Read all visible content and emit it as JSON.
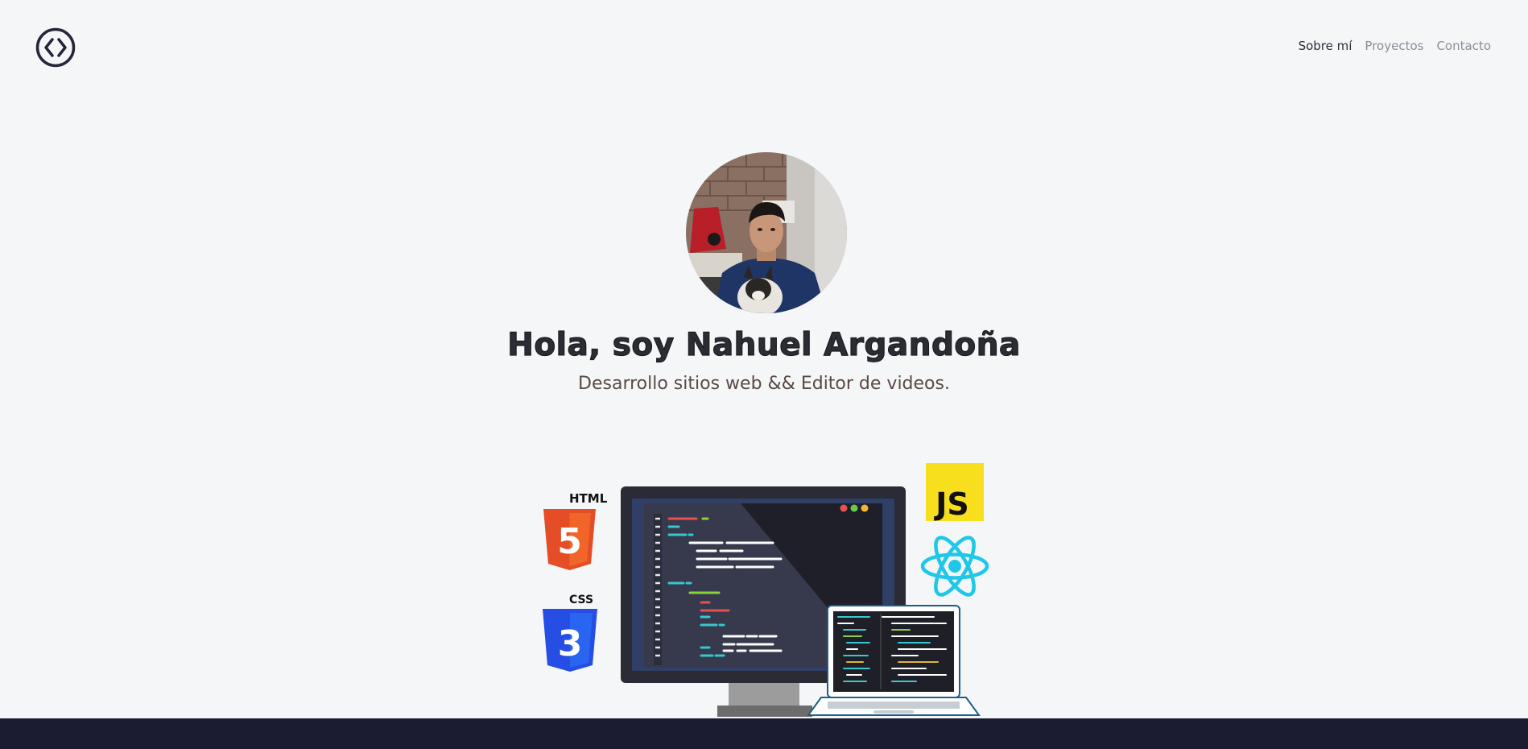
{
  "header": {
    "logo_icon": "code-brackets-icon",
    "nav": [
      {
        "label": "Sobre mí",
        "active": true
      },
      {
        "label": "Proyectos",
        "active": false
      },
      {
        "label": "Contacto",
        "active": false
      }
    ]
  },
  "hero": {
    "title": "Hola, soy Nahuel Argandoña",
    "subtitle": "Desarrollo sitios web && Editor de videos."
  },
  "tech_logos": {
    "html": "HTML",
    "html_number": "5",
    "css": "CSS",
    "css_number": "3",
    "js": "JS",
    "react_icon": "react-atom-icon"
  },
  "colors": {
    "background": "#f4f6f8",
    "footer": "#1b1c31",
    "html_orange": "#e44d26",
    "css_blue": "#264de4",
    "js_yellow": "#f7df1e",
    "react_cyan": "#1fc8e8"
  }
}
